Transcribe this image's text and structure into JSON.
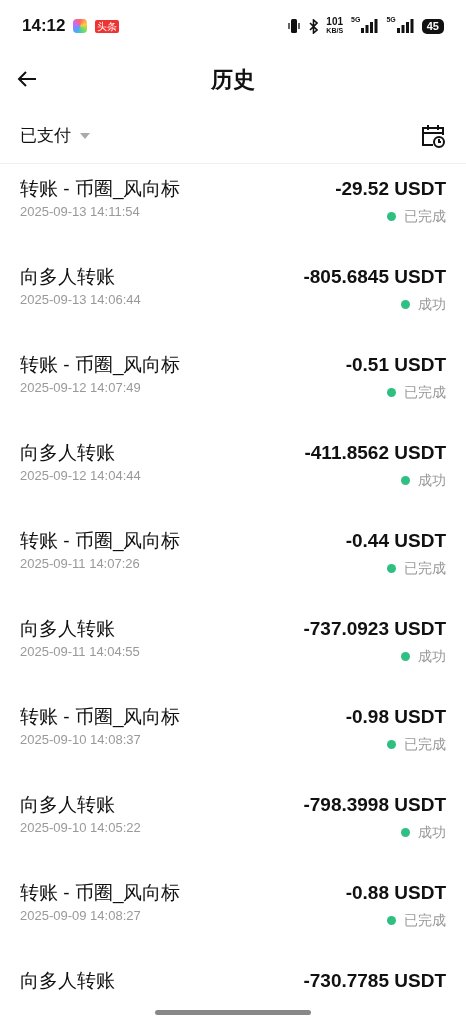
{
  "status_bar": {
    "time": "14:12",
    "app_badge": "头条",
    "speed": "101",
    "speed_unit": "KB/S",
    "network_1": "5G",
    "network_2": "5G",
    "battery": "45"
  },
  "header": {
    "title": "历史"
  },
  "filter": {
    "label": "已支付"
  },
  "transactions": [
    {
      "title": "转账 - 币圈_风向标",
      "amount": "-29.52 USDT",
      "date": "2025-09-13 14:11:54",
      "status": "已完成"
    },
    {
      "title": "向多人转账",
      "amount": "-805.6845 USDT",
      "date": "2025-09-13 14:06:44",
      "status": "成功"
    },
    {
      "title": "转账 - 币圈_风向标",
      "amount": "-0.51 USDT",
      "date": "2025-09-12 14:07:49",
      "status": "已完成"
    },
    {
      "title": "向多人转账",
      "amount": "-411.8562 USDT",
      "date": "2025-09-12 14:04:44",
      "status": "成功"
    },
    {
      "title": "转账 - 币圈_风向标",
      "amount": "-0.44 USDT",
      "date": "2025-09-11 14:07:26",
      "status": "已完成"
    },
    {
      "title": "向多人转账",
      "amount": "-737.0923 USDT",
      "date": "2025-09-11 14:04:55",
      "status": "成功"
    },
    {
      "title": "转账 - 币圈_风向标",
      "amount": "-0.98 USDT",
      "date": "2025-09-10 14:08:37",
      "status": "已完成"
    },
    {
      "title": "向多人转账",
      "amount": "-798.3998 USDT",
      "date": "2025-09-10 14:05:22",
      "status": "成功"
    },
    {
      "title": "转账 - 币圈_风向标",
      "amount": "-0.88 USDT",
      "date": "2025-09-09 14:08:27",
      "status": "已完成"
    },
    {
      "title": "向多人转账",
      "amount": "-730.7785 USDT"
    }
  ]
}
